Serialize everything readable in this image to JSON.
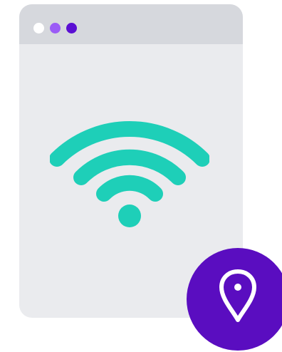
{
  "window": {
    "traffic_dots": [
      {
        "name": "dot-white",
        "color": "#ffffff"
      },
      {
        "name": "dot-purple",
        "color": "#9b5cf6"
      },
      {
        "name": "dot-indigo",
        "color": "#5b0fd3"
      }
    ],
    "body_color": "#eaebee",
    "titlebar_color": "#d6d8dd"
  },
  "wifi": {
    "icon": "wifi-icon",
    "color": "#1ecfb8"
  },
  "location_badge": {
    "icon": "map-pin-icon",
    "background_color": "#5a0dc0",
    "icon_color": "#ffffff"
  }
}
